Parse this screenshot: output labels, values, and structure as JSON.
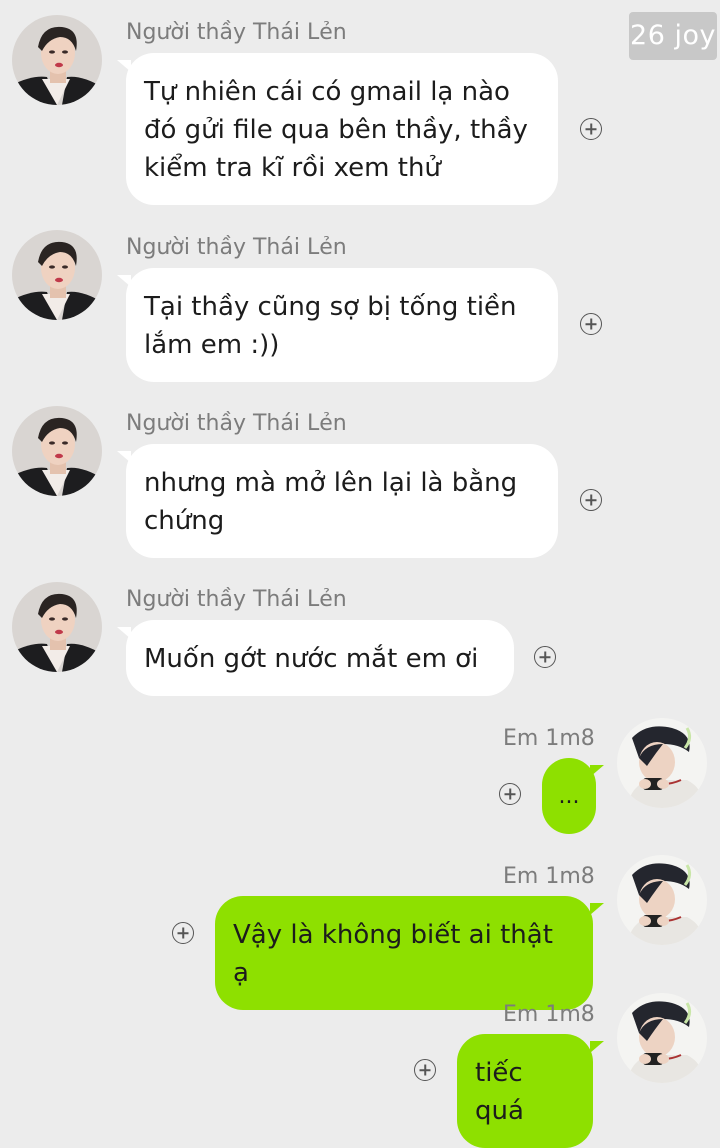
{
  "watermark": "26 joy",
  "teacher_name": "Người thầy Thái Lẻn",
  "student_name": "Em 1m8",
  "messages": [
    {
      "from": "teacher",
      "text": "Tự nhiên cái có gmail lạ nào đó gửi file qua bên thầy, thầy kiểm tra kĩ rồi xem thử"
    },
    {
      "from": "teacher",
      "text": "Tại thầy cũng sợ bị tống tiền lắm em :))"
    },
    {
      "from": "teacher",
      "text": "nhưng mà mở lên lại là bằng chứng"
    },
    {
      "from": "teacher",
      "text": "Muốn gớt nước mắt em ơi"
    },
    {
      "from": "student",
      "text": "..."
    },
    {
      "from": "student",
      "text": "Vậy là không biết ai thật ạ"
    },
    {
      "from": "student",
      "text": "tiếc quá"
    }
  ],
  "colors": {
    "background": "#ececec",
    "incoming_bubble": "#ffffff",
    "outgoing_bubble": "#8ee000"
  },
  "icons": {
    "add_reaction": "plus-circle-icon"
  }
}
